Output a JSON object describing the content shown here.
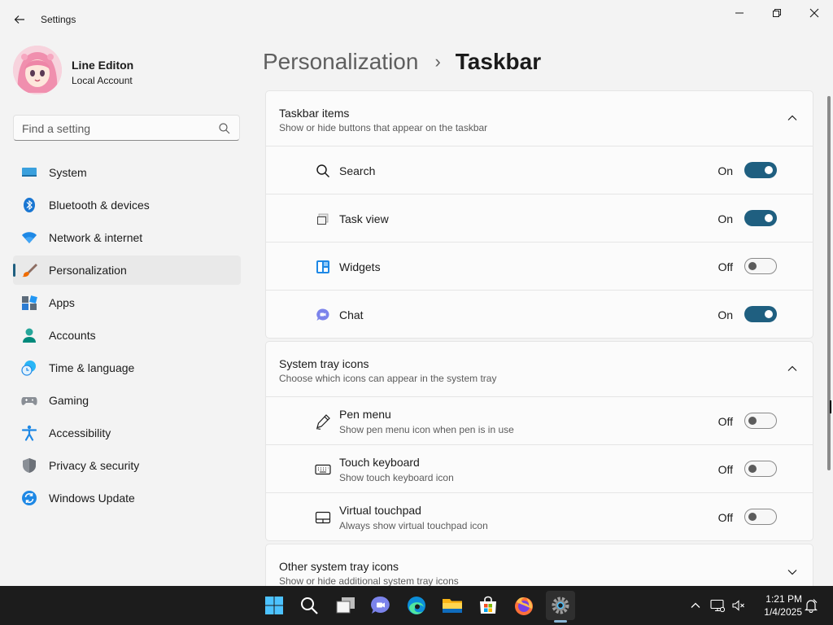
{
  "window": {
    "title": "Settings"
  },
  "profile": {
    "name": "Line Editon",
    "account_type": "Local Account"
  },
  "search": {
    "placeholder": "Find a setting"
  },
  "sidebar": {
    "items": [
      {
        "label": "System",
        "icon": "system-icon",
        "active": false
      },
      {
        "label": "Bluetooth & devices",
        "icon": "bluetooth-icon",
        "active": false
      },
      {
        "label": "Network & internet",
        "icon": "wifi-icon",
        "active": false
      },
      {
        "label": "Personalization",
        "icon": "brush-icon",
        "active": true
      },
      {
        "label": "Apps",
        "icon": "apps-icon",
        "active": false
      },
      {
        "label": "Accounts",
        "icon": "accounts-icon",
        "active": false
      },
      {
        "label": "Time & language",
        "icon": "clock-globe-icon",
        "active": false
      },
      {
        "label": "Gaming",
        "icon": "gamepad-icon",
        "active": false
      },
      {
        "label": "Accessibility",
        "icon": "accessibility-icon",
        "active": false
      },
      {
        "label": "Privacy & security",
        "icon": "shield-icon",
        "active": false
      },
      {
        "label": "Windows Update",
        "icon": "update-icon",
        "active": false
      }
    ]
  },
  "breadcrumb": {
    "parent": "Personalization",
    "separator": "›",
    "current": "Taskbar"
  },
  "sections": {
    "taskbar_items": {
      "title": "Taskbar items",
      "description": "Show or hide buttons that appear on the taskbar",
      "rows": [
        {
          "label": "Search",
          "state": "On",
          "on": true,
          "icon": "search-icon"
        },
        {
          "label": "Task view",
          "state": "On",
          "on": true,
          "icon": "task-view-icon"
        },
        {
          "label": "Widgets",
          "state": "Off",
          "on": false,
          "icon": "widgets-icon"
        },
        {
          "label": "Chat",
          "state": "On",
          "on": true,
          "icon": "chat-icon"
        }
      ]
    },
    "system_tray": {
      "title": "System tray icons",
      "description": "Choose which icons can appear in the system tray",
      "rows": [
        {
          "label": "Pen menu",
          "sub": "Show pen menu icon when pen is in use",
          "state": "Off",
          "on": false,
          "icon": "pen-icon"
        },
        {
          "label": "Touch keyboard",
          "sub": "Show touch keyboard icon",
          "state": "Off",
          "on": false,
          "icon": "keyboard-icon"
        },
        {
          "label": "Virtual touchpad",
          "sub": "Always show virtual touchpad icon",
          "state": "Off",
          "on": false,
          "icon": "touchpad-icon"
        }
      ]
    },
    "other_tray": {
      "title": "Other system tray icons",
      "description": "Show or hide additional system tray icons"
    }
  },
  "taskbar": {
    "apps": [
      "start-icon",
      "search-icon",
      "task-view-icon",
      "teams-chat-icon",
      "edge-icon",
      "file-explorer-icon",
      "store-icon",
      "firefox-icon",
      "settings-icon"
    ],
    "clock_time": "1:21 PM",
    "clock_date": "1/4/2025"
  },
  "colors": {
    "accent": "#1f5f80",
    "taskbar_bg": "#1c1c1c",
    "window_bg": "#f3f3f3",
    "card_bg": "#fbfbfb"
  }
}
